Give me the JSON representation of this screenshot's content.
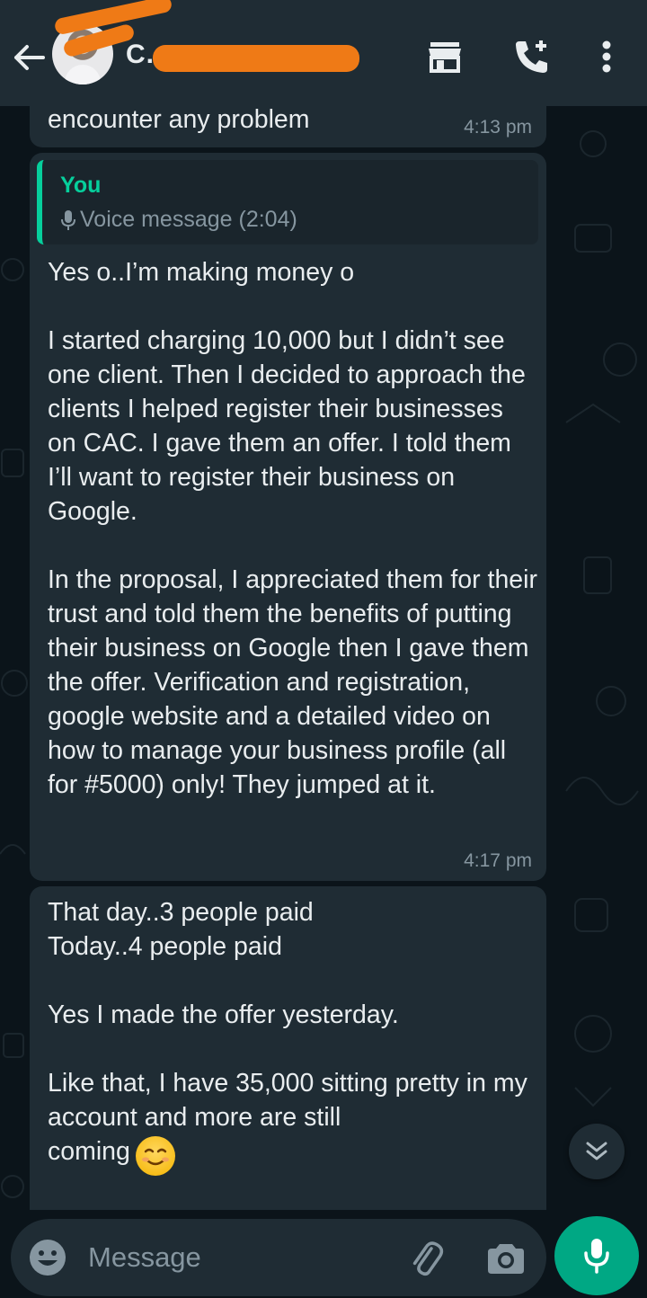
{
  "header": {
    "contact_name": "C... ...s...",
    "back_label": "Back",
    "colors": {
      "bar": "#1f2c34",
      "redaction": "#ef7a16"
    }
  },
  "messages": [
    {
      "id": "m1",
      "text": "encounter any problem",
      "time": "4:13 pm"
    },
    {
      "id": "m2",
      "quote": {
        "author": "You",
        "body": "Voice message (2:04)"
      },
      "text": "Yes o..I’m making money o\n\nI started charging 10,000 but I didn’t see one client. Then I decided to approach the clients I helped register their businesses on CAC. I gave them an offer. I told them I’ll want to register their business on Google.\n\nIn the proposal, I appreciated them for their trust and told them the benefits of putting their business on Google then I gave them the offer. Verification and registration, google website and a detailed video on how to manage your business profile (all for #5000) only! They jumped at it.",
      "time": "4:17 pm"
    },
    {
      "id": "m3",
      "text": "That day..3 people paid\nToday..4 people paid\n\nYes I made the offer yesterday.\n\nLike that, I have 35,000 sitting pretty in my account and more are still\ncoming",
      "emoji": "smiling-face-emoji"
    }
  ],
  "composer": {
    "placeholder": "Message"
  },
  "colors": {
    "background": "#0b141a",
    "bubble": "#1f2c34",
    "accent": "#00a884",
    "quote_accent": "#06cf9c",
    "meta_text": "#8696a0"
  },
  "icons": [
    "back-arrow-icon",
    "store-icon",
    "add-call-icon",
    "more-vert-icon",
    "mic-icon",
    "emoji-icon",
    "paperclip-icon",
    "camera-icon",
    "double-chevron-down-icon"
  ]
}
